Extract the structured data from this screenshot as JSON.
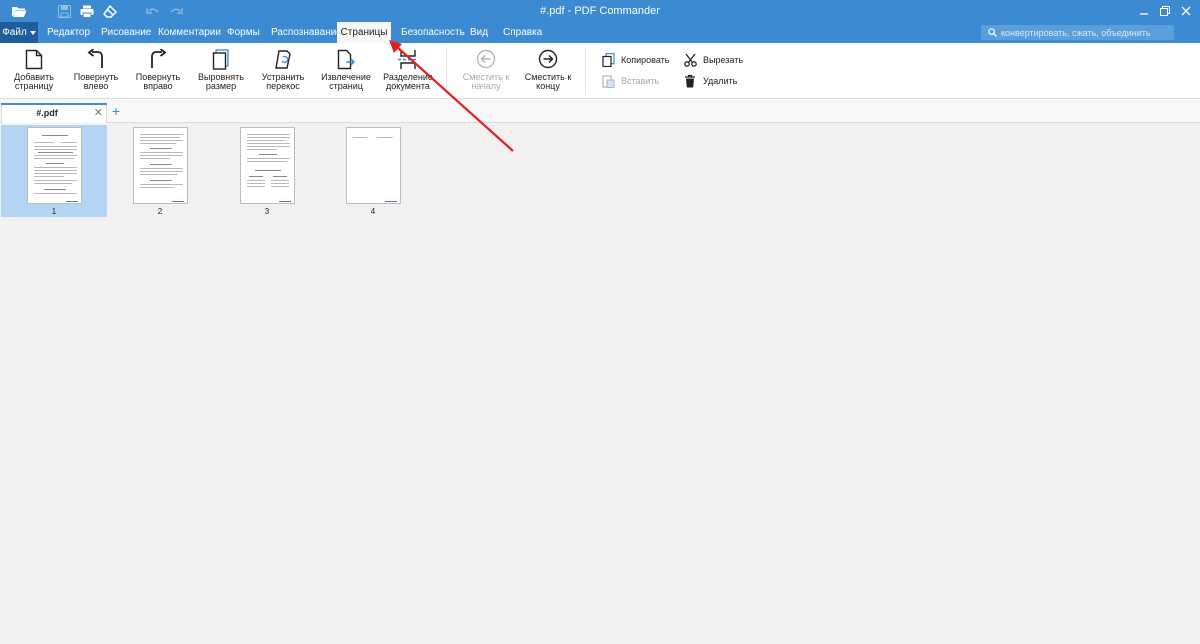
{
  "window": {
    "title": "#.pdf - PDF Commander"
  },
  "menubar": {
    "file_label": "Файл",
    "tabs": [
      "Редактор",
      "Рисование",
      "Комментарии",
      "Формы",
      "Распознавание",
      "Страницы",
      "Безопасность",
      "Вид",
      "Справка"
    ],
    "active_tab": "Страницы",
    "search_placeholder": "конвертировать, сжать, объединить"
  },
  "ribbon": {
    "buttons": [
      {
        "label": "Добавить страницу",
        "icon": "add-page-icon",
        "enabled": true
      },
      {
        "label": "Повернуть влево",
        "icon": "rotate-left-icon",
        "enabled": true
      },
      {
        "label": "Повернуть вправо",
        "icon": "rotate-right-icon",
        "enabled": true
      },
      {
        "label": "Выровнять размер",
        "icon": "align-size-icon",
        "enabled": true
      },
      {
        "label": "Устранить перекос",
        "icon": "deskew-icon",
        "enabled": true
      },
      {
        "label": "Извлечение страниц",
        "icon": "extract-pages-icon",
        "enabled": true
      },
      {
        "label": "Разделение документа",
        "icon": "split-document-icon",
        "enabled": true
      },
      {
        "label": "Сместить к началу",
        "icon": "move-to-start-icon",
        "enabled": false
      },
      {
        "label": "Сместить к концу",
        "icon": "move-to-end-icon",
        "enabled": true
      }
    ],
    "small_buttons": [
      {
        "label": "Копировать",
        "icon": "copy-icon",
        "enabled": true
      },
      {
        "label": "Вставить",
        "icon": "paste-icon",
        "enabled": false
      },
      {
        "label": "Вырезать",
        "icon": "cut-icon",
        "enabled": true
      },
      {
        "label": "Удалить",
        "icon": "delete-icon",
        "enabled": true
      }
    ]
  },
  "document_tabs": [
    {
      "name": "#.pdf",
      "active": true
    }
  ],
  "pages": [
    {
      "number": "1",
      "selected": true
    },
    {
      "number": "2",
      "selected": false
    },
    {
      "number": "3",
      "selected": false
    },
    {
      "number": "4",
      "selected": false
    }
  ],
  "colors": {
    "accent": "#3c8ad1",
    "file_button": "#1f5d9c",
    "selection": "#b3d4f2",
    "annotation_arrow": "#e02020"
  }
}
